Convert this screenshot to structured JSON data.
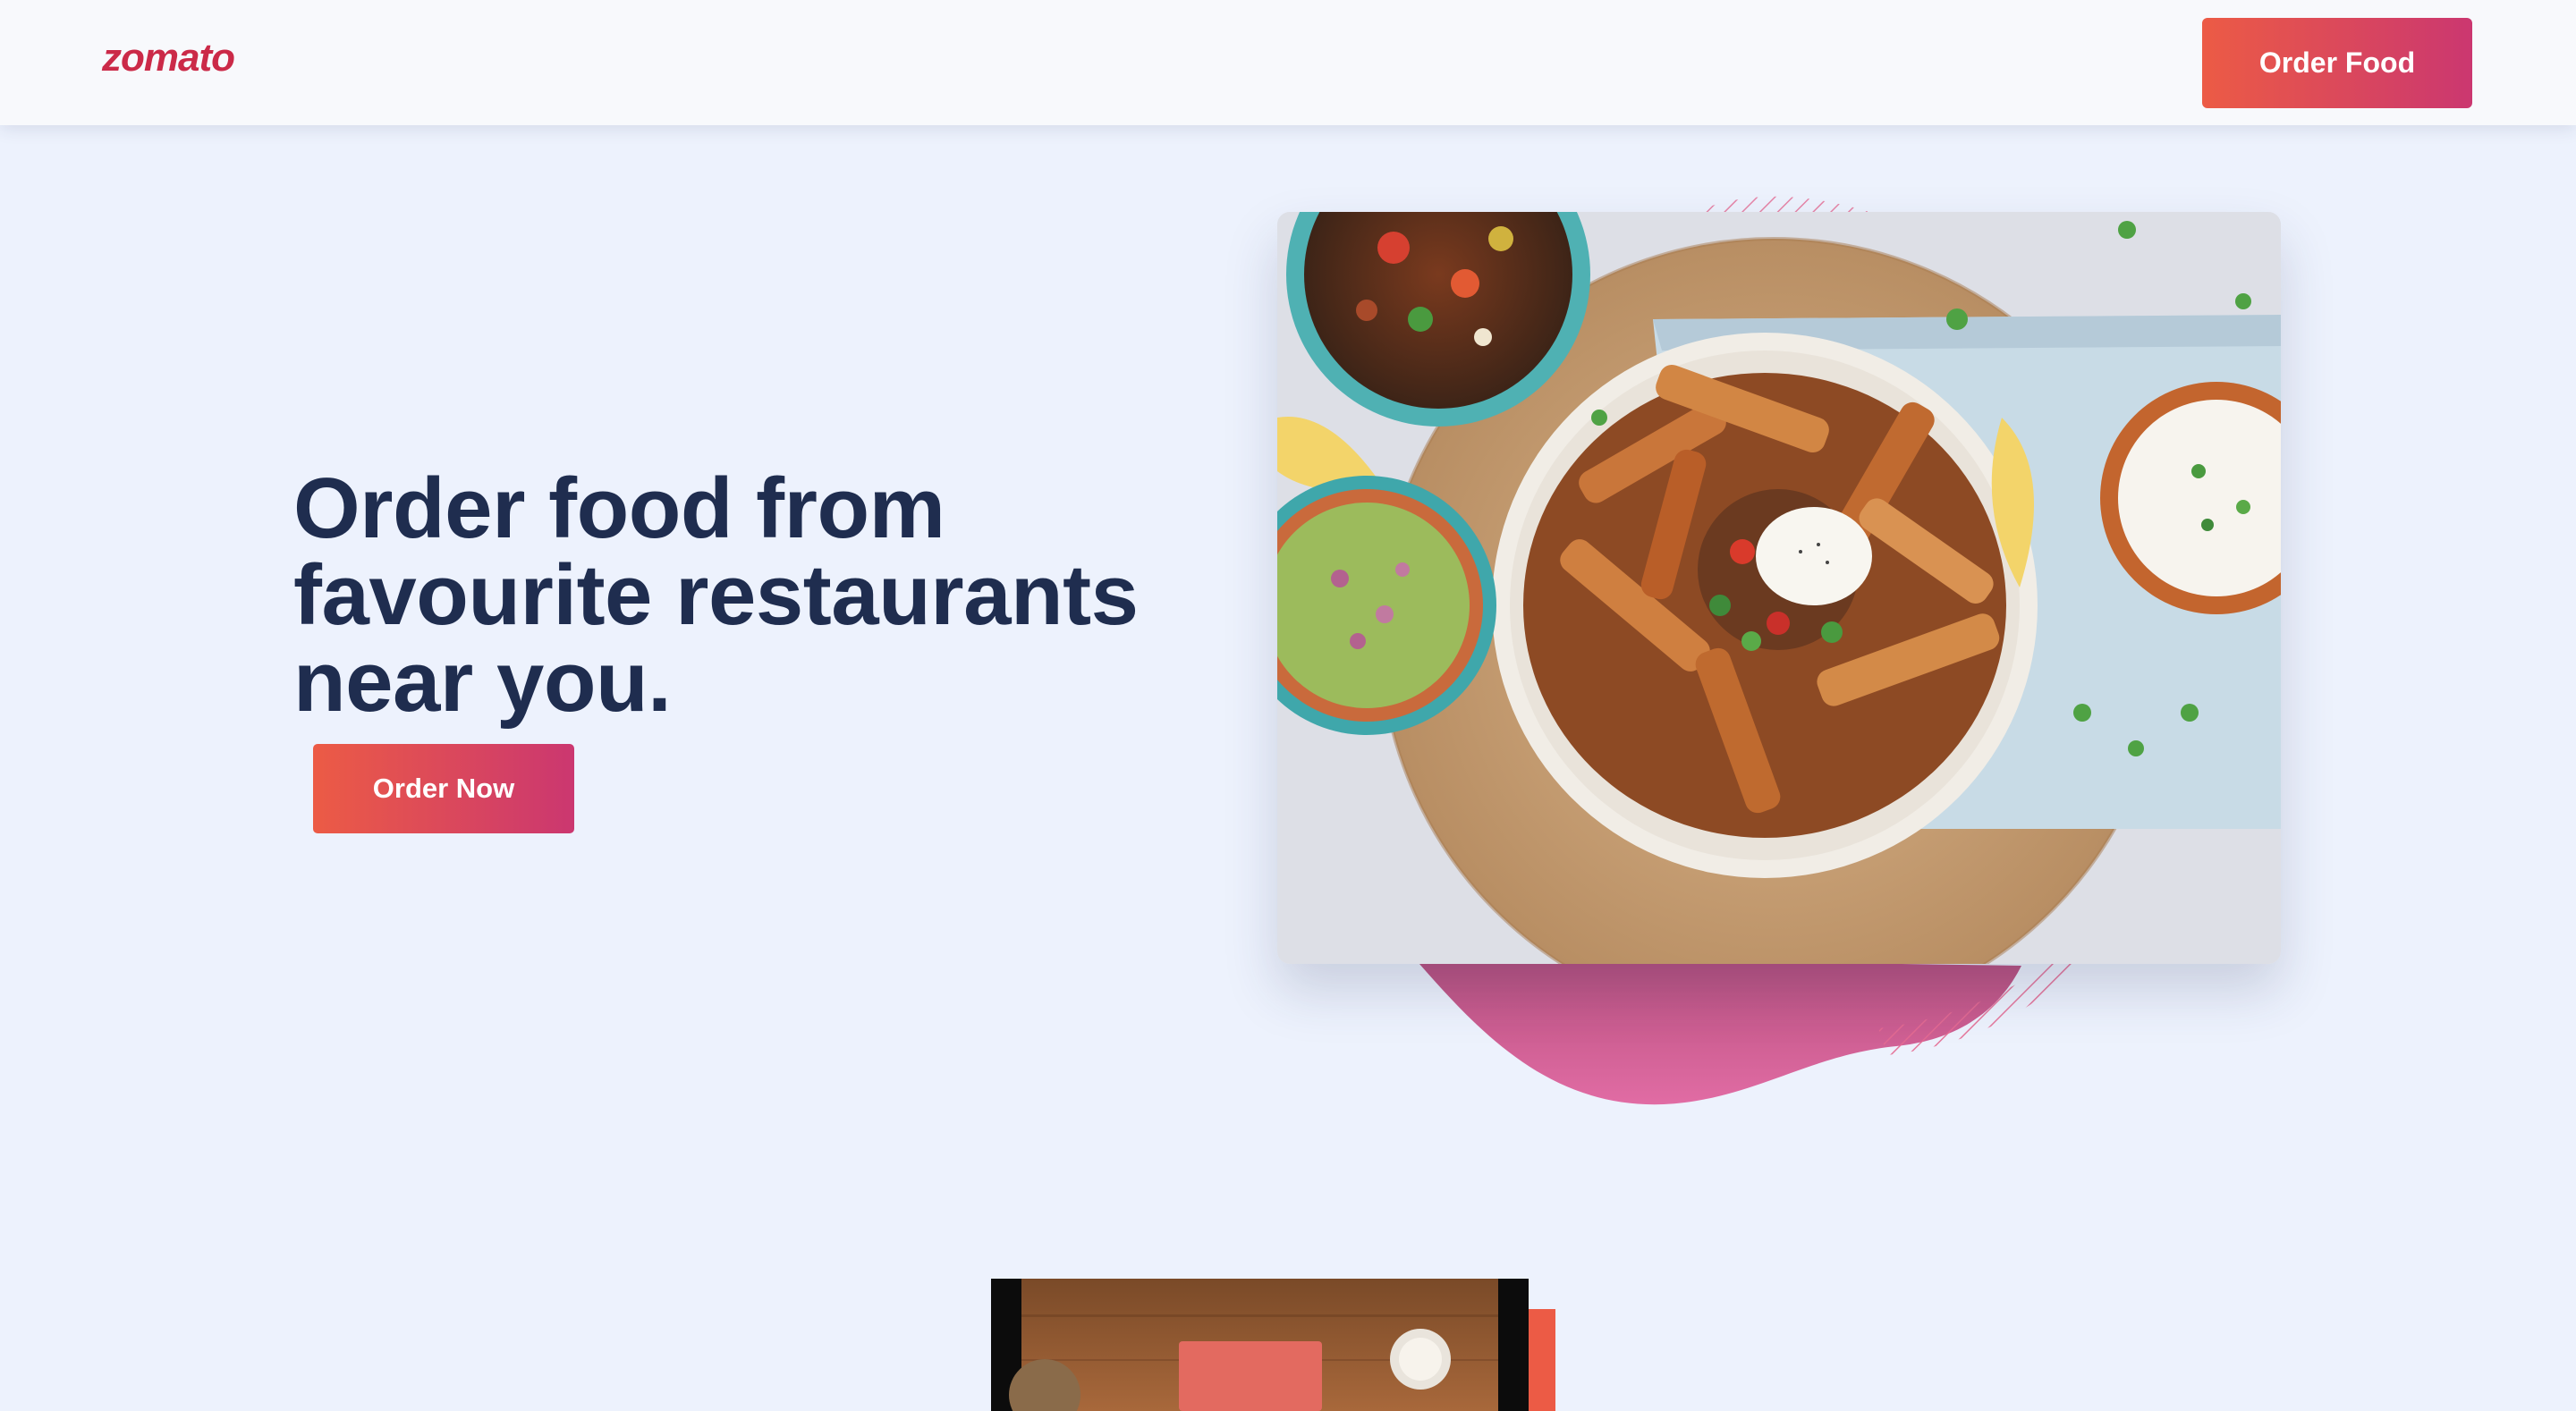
{
  "brand": {
    "logo_text": "zomato",
    "logo_color": "#cb2a48",
    "accent_gradient": [
      "#ec5b45",
      "#cb3770"
    ]
  },
  "navbar": {
    "order_food_label": "Order Food"
  },
  "hero": {
    "heading": "Order food from favourite restaurants near you.",
    "heading_color": "#1f2d4f",
    "cta_label": "Order Now",
    "decor": {
      "blob_color": "#e06aa3",
      "hatch_color": "#e46a92"
    },
    "image": {
      "subject": "bowl of sweet potato fries with salsa and sour cream on a wooden board, with side bowls of chili, guacamole and yogurt dip",
      "icon": "food-photo"
    }
  },
  "video_preview": {
    "subject": "zomato delivery box on a wooden table"
  }
}
